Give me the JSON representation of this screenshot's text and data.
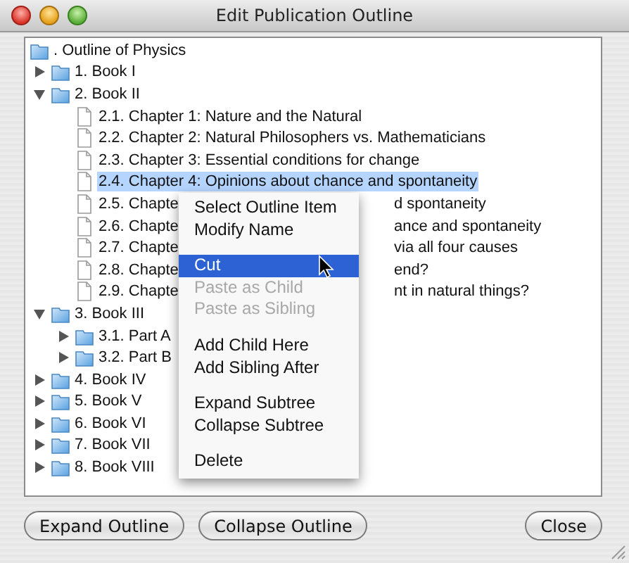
{
  "window": {
    "title": "Edit Publication Outline"
  },
  "outline": {
    "root": {
      "label": ". Outline of Physics",
      "kind": "folder",
      "selected": false,
      "children": [
        {
          "label": "1. Book I",
          "kind": "folder",
          "expanded": false,
          "selected": false
        },
        {
          "label": "2. Book II",
          "kind": "folder",
          "expanded": true,
          "selected": false,
          "children": [
            {
              "label": "2.1. Chapter 1: Nature and the Natural",
              "kind": "document",
              "selected": false
            },
            {
              "label": "2.2. Chapter 2: Natural Philosophers vs. Mathematicians",
              "kind": "document",
              "selected": false
            },
            {
              "label": "2.3. Chapter 3:  Essential conditions for change",
              "kind": "document",
              "selected": false
            },
            {
              "label": "2.4. Chapter 4: Opinions about chance and spontaneity",
              "kind": "document",
              "selected": true
            },
            {
              "label": "2.5. Chapte",
              "tail": "d spontaneity",
              "kind": "document",
              "selected": false
            },
            {
              "label": "2.6. Chapte",
              "tail": "ance and spontaneity",
              "kind": "document",
              "selected": false
            },
            {
              "label": "2.7. Chapte",
              "tail": "via all four causes",
              "kind": "document",
              "selected": false
            },
            {
              "label": "2.8. Chapte",
              "tail": "end?",
              "kind": "document",
              "selected": false
            },
            {
              "label": "2.9. Chapte",
              "tail": "nt in natural things?",
              "kind": "document",
              "selected": false
            }
          ]
        },
        {
          "label": "3. Book III",
          "kind": "folder",
          "expanded": true,
          "selected": false,
          "children": [
            {
              "label": "3.1. Part A",
              "kind": "folder",
              "expanded": false,
              "selected": false
            },
            {
              "label": "3.2. Part B",
              "kind": "folder",
              "expanded": false,
              "selected": false
            }
          ]
        },
        {
          "label": "4. Book IV",
          "kind": "folder",
          "expanded": false,
          "selected": false
        },
        {
          "label": "5. Book V",
          "kind": "folder",
          "expanded": false,
          "selected": false
        },
        {
          "label": "6. Book VI",
          "kind": "folder",
          "expanded": false,
          "selected": false
        },
        {
          "label": "7. Book VII",
          "kind": "folder",
          "expanded": false,
          "selected": false
        },
        {
          "label": "8. Book VIII",
          "kind": "folder",
          "expanded": false,
          "selected": false
        }
      ]
    }
  },
  "context_menu": {
    "items": [
      {
        "kind": "item",
        "label": "Select Outline Item",
        "selected": false,
        "disabled": false
      },
      {
        "kind": "item",
        "label": "Modify Name",
        "selected": false,
        "disabled": false
      },
      {
        "kind": "separator"
      },
      {
        "kind": "item",
        "label": "Cut",
        "selected": true,
        "disabled": false
      },
      {
        "kind": "item",
        "label": "Paste as Child",
        "selected": false,
        "disabled": true
      },
      {
        "kind": "item",
        "label": "Paste as Sibling",
        "selected": false,
        "disabled": true
      },
      {
        "kind": "separator"
      },
      {
        "kind": "item",
        "label": "Add Child Here",
        "selected": false,
        "disabled": false
      },
      {
        "kind": "item",
        "label": "Add Sibling After",
        "selected": false,
        "disabled": false
      },
      {
        "kind": "separator"
      },
      {
        "kind": "item",
        "label": "Expand Subtree",
        "selected": false,
        "disabled": false
      },
      {
        "kind": "item",
        "label": "Collapse Subtree",
        "selected": false,
        "disabled": false
      },
      {
        "kind": "separator"
      },
      {
        "kind": "item",
        "label": "Delete",
        "selected": false,
        "disabled": false
      }
    ]
  },
  "buttons": {
    "left": [
      {
        "label": "Expand Outline"
      },
      {
        "label": "Collapse Outline"
      }
    ],
    "right": [
      {
        "label": "Close"
      }
    ]
  }
}
